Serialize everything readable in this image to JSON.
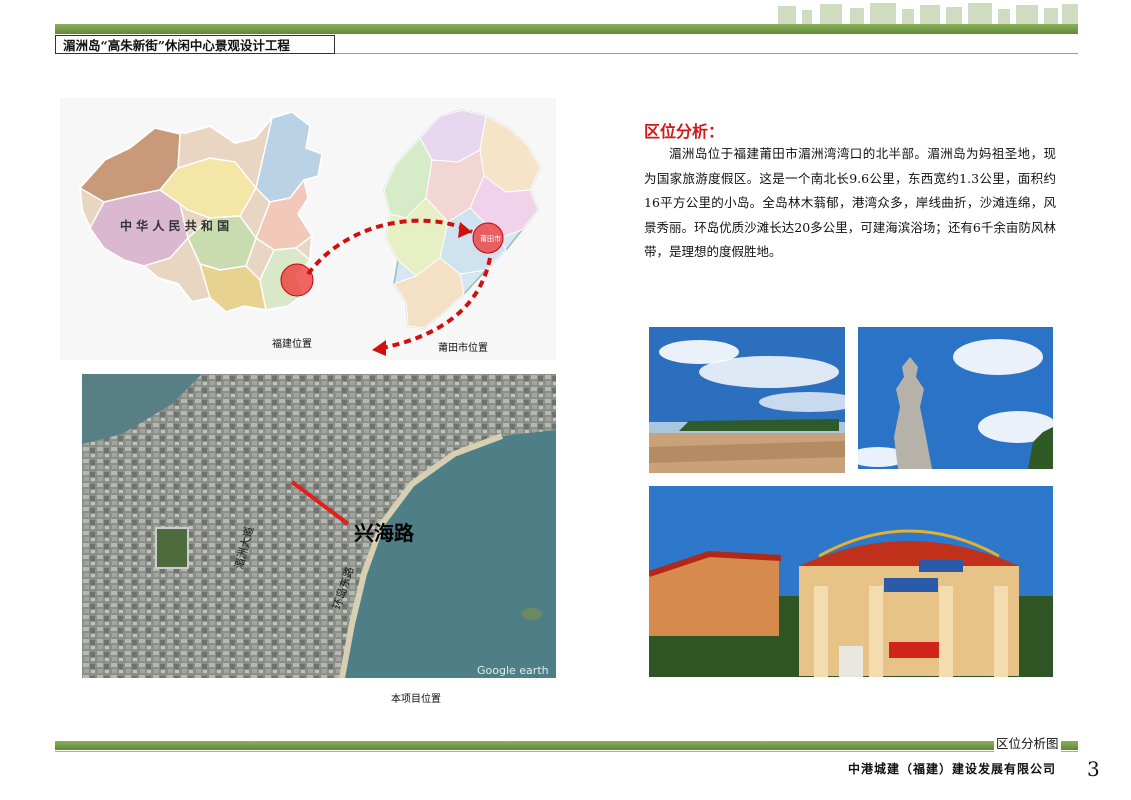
{
  "header": {
    "title": "湄洲岛“高朱新街”休闲中心景观设计工程"
  },
  "maps": {
    "fujian_caption": "福建位置",
    "putian_caption": "莆田市位置",
    "china_map_label": "中 华 人 民 共 和 国",
    "putian_dot_label": "莆田市"
  },
  "satellite": {
    "caption": "本项目位置",
    "road_label": "兴海路",
    "road_label_2": "湄洲大道",
    "road_label_3": "环岛东路",
    "watermark": "Google earth"
  },
  "analysis": {
    "title": "区位分析：",
    "body": "湄洲岛位于福建莆田市湄洲湾湾口的北半部。湄洲岛为妈祖圣地，现为国家旅游度假区。这是一个南北长9.6公里，东西宽约1.3公里，面积约16平方公里的小岛。全岛林木蓊郁，港湾众多，岸线曲折，沙滩连绵，风景秀丽。环岛优质沙滩长达20多公里，可建海滨浴场；还有6千余亩防风林带，是理想的度假胜地。"
  },
  "footer": {
    "figure_label": "区位分析图",
    "company": "中港城建（福建）建设发展有限公司",
    "page": "3"
  },
  "colors": {
    "band_green": "#6f9a3f",
    "accent_red": "#d11a1a"
  }
}
